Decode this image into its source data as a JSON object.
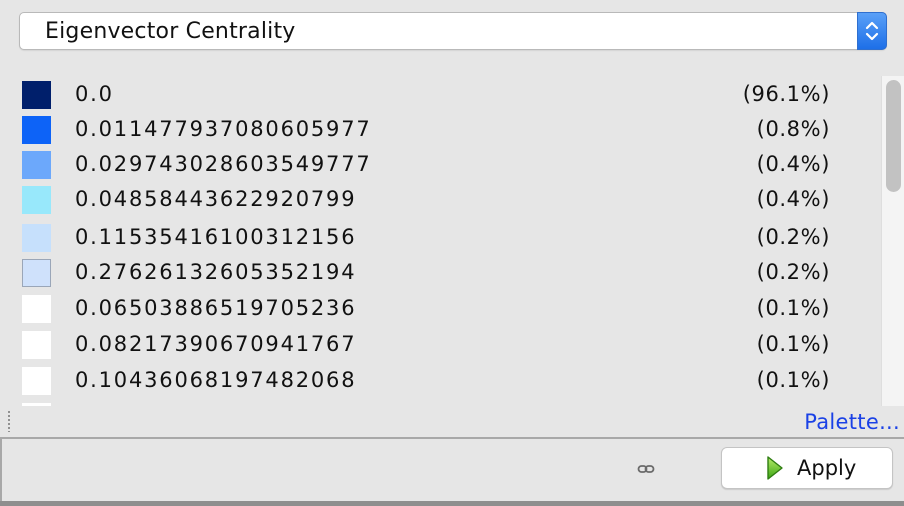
{
  "selector": {
    "value": "Eigenvector Centrality"
  },
  "legend": {
    "items": [
      {
        "color": "#001f6b",
        "value": "0.0",
        "percent": "(96.1%)"
      },
      {
        "color": "#0d63f7",
        "value": "0.011477937080605977",
        "percent": "(0.8%)"
      },
      {
        "color": "#6ca8fb",
        "value": "0.029743028603549777",
        "percent": "(0.4%)"
      },
      {
        "color": "#98e8fb",
        "value": "0.04858443622920799",
        "percent": "(0.4%)"
      },
      {
        "color": "#c6e0fc",
        "value": "0.11535416100312156",
        "percent": "(0.2%)"
      },
      {
        "color": "#cfe1fb",
        "value": "0.27626132605352194",
        "percent": "(0.2%)"
      },
      {
        "color": "#ffffff",
        "value": "0.06503886519705236",
        "percent": "(0.1%)"
      },
      {
        "color": "#ffffff",
        "value": "0.08217390670941767",
        "percent": "(0.1%)"
      },
      {
        "color": "#ffffff",
        "value": "0.10436068197482068",
        "percent": "(0.1%)"
      },
      {
        "color": "#ffffff",
        "value": "",
        "percent": ""
      }
    ]
  },
  "palette_link": "Palette...",
  "footer": {
    "apply_label": "Apply",
    "link_icon": "chain-link-icon",
    "apply_icon": "play-icon"
  }
}
